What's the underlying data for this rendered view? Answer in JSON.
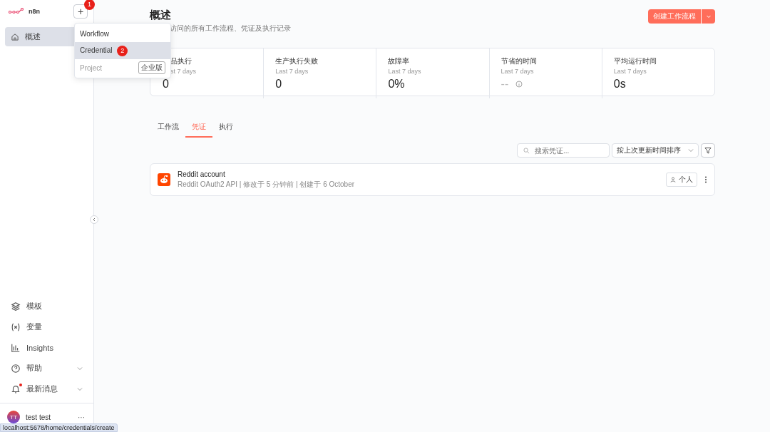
{
  "sidebar": {
    "logo": "n8n",
    "new_button": {
      "label": "+",
      "badge": "1"
    },
    "items": [
      {
        "label": "概述",
        "selected": true
      }
    ],
    "bottom_items": [
      {
        "label": "模板",
        "expandable": false,
        "unread": false
      },
      {
        "label": "变量",
        "expandable": false,
        "unread": false
      },
      {
        "label": "Insights",
        "expandable": false,
        "unread": false
      },
      {
        "label": "帮助",
        "expandable": true,
        "unread": false
      },
      {
        "label": "最新消息",
        "expandable": true,
        "unread": true
      }
    ],
    "user": {
      "initials": "TT",
      "name": "test test",
      "more": "···"
    }
  },
  "new_menu": {
    "items": [
      {
        "label": "Workflow",
        "selected": false,
        "disabled": false
      },
      {
        "label": "Credential",
        "selected": true,
        "disabled": false,
        "badge": "2"
      },
      {
        "label": "Project",
        "selected": false,
        "disabled": true,
        "tag": "企业版"
      }
    ]
  },
  "header": {
    "title": "概述",
    "subtitle": "访问的所有工作流程、凭证及执行记录",
    "create_button": "创建工作流程"
  },
  "stats": [
    {
      "title": "品执行",
      "subtitle": "st 7 days",
      "value": "0",
      "muted": false
    },
    {
      "title": "生产执行失败",
      "subtitle": "Last 7 days",
      "value": "0",
      "muted": false
    },
    {
      "title": "故障率",
      "subtitle": "Last 7 days",
      "value": "0%",
      "muted": false
    },
    {
      "title": "节省的时间",
      "subtitle": "Last 7 days",
      "value": "--",
      "muted": true
    },
    {
      "title": "平均运行时间",
      "subtitle": "Last 7 days",
      "value": "0s",
      "muted": false
    }
  ],
  "tabs": [
    {
      "label": "工作流",
      "selected": false
    },
    {
      "label": "凭证",
      "selected": true
    },
    {
      "label": "执行",
      "selected": false
    }
  ],
  "search": {
    "placeholder": "搜索凭证..."
  },
  "sort": {
    "value": "按上次更新时间排序"
  },
  "credentials": [
    {
      "name": "Reddit account",
      "meta": "Reddit OAuth2 API | 修改于 5 分钟前 | 创建于 6 October",
      "owner": "个人"
    }
  ],
  "status_bar": "localhost:5678/home/credentials/create"
}
